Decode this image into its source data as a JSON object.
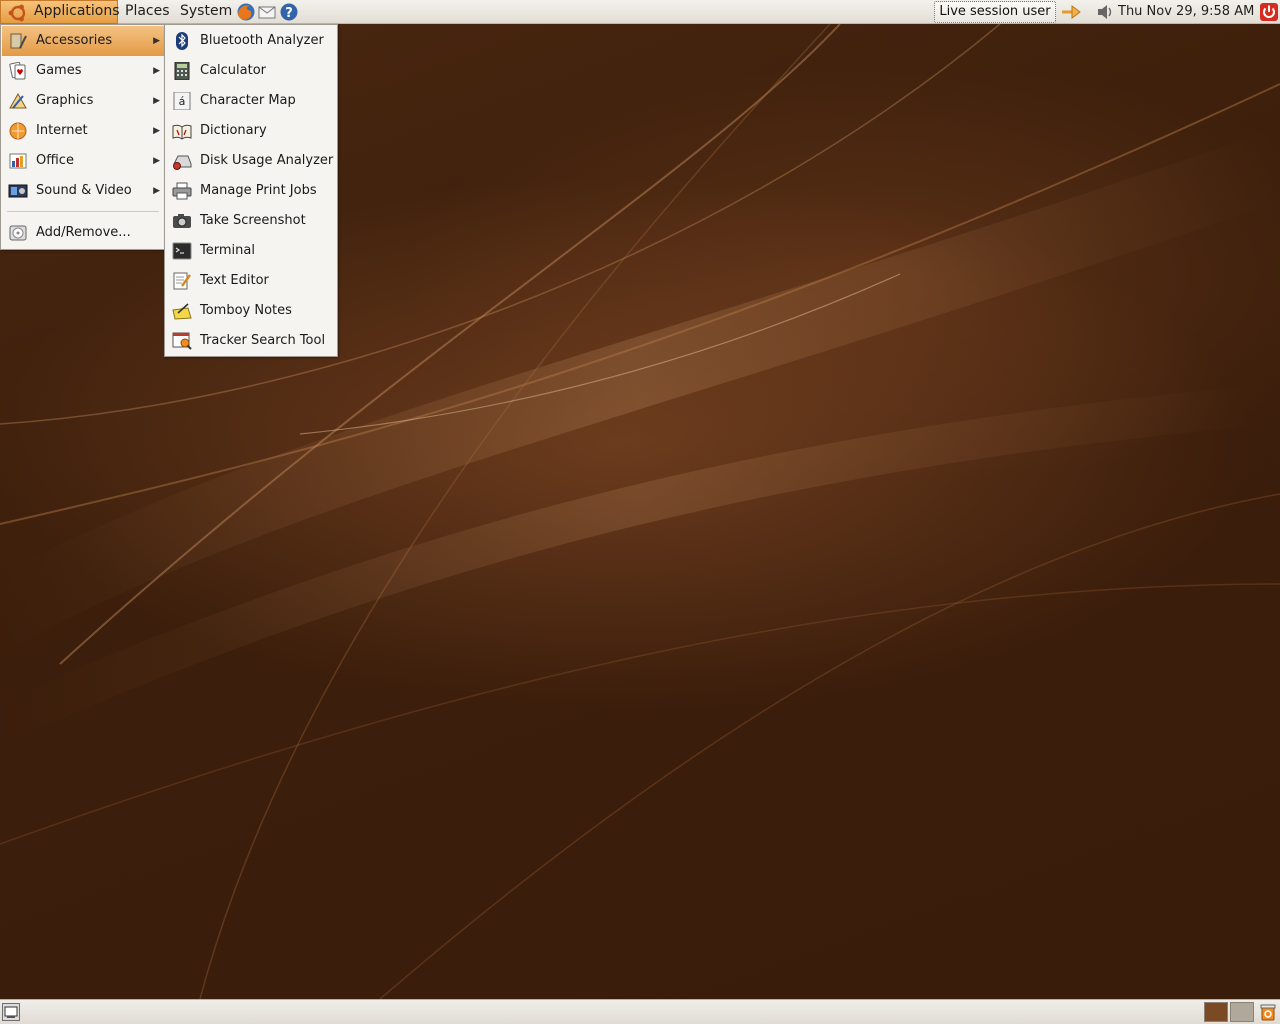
{
  "top_panel": {
    "menus": [
      "Applications",
      "Places",
      "System"
    ],
    "launchers": [
      "firefox-icon",
      "evolution-mail-icon",
      "help-icon"
    ],
    "user_switcher_label": "Live session user",
    "clock_text": "Thu Nov 29,  9:58 AM"
  },
  "applications_menu": {
    "items": [
      {
        "label": "Accessories",
        "icon": "accessories-icon"
      },
      {
        "label": "Games",
        "icon": "games-icon"
      },
      {
        "label": "Graphics",
        "icon": "graphics-icon"
      },
      {
        "label": "Internet",
        "icon": "internet-icon"
      },
      {
        "label": "Office",
        "icon": "office-icon"
      },
      {
        "label": "Sound & Video",
        "icon": "sound-video-icon"
      }
    ],
    "footer_item": {
      "label": "Add/Remove...",
      "icon": "add-remove-icon"
    }
  },
  "accessories_submenu": {
    "items": [
      {
        "label": "Bluetooth Analyzer",
        "icon": "bluetooth-icon"
      },
      {
        "label": "Calculator",
        "icon": "calculator-icon"
      },
      {
        "label": "Character Map",
        "icon": "character-map-icon"
      },
      {
        "label": "Dictionary",
        "icon": "dictionary-icon"
      },
      {
        "label": "Disk Usage Analyzer",
        "icon": "disk-usage-icon"
      },
      {
        "label": "Manage Print Jobs",
        "icon": "printer-icon"
      },
      {
        "label": "Take Screenshot",
        "icon": "camera-icon"
      },
      {
        "label": "Terminal",
        "icon": "terminal-icon"
      },
      {
        "label": "Text Editor",
        "icon": "text-editor-icon"
      },
      {
        "label": "Tomboy Notes",
        "icon": "tomboy-icon"
      },
      {
        "label": "Tracker Search Tool",
        "icon": "tracker-search-icon"
      }
    ]
  },
  "colors": {
    "menu_highlight": "#e39a45",
    "wallpaper_dark": "#3a1c0b",
    "workspace_active": "#7a4a24",
    "workspace_inactive": "#b1a89c"
  }
}
